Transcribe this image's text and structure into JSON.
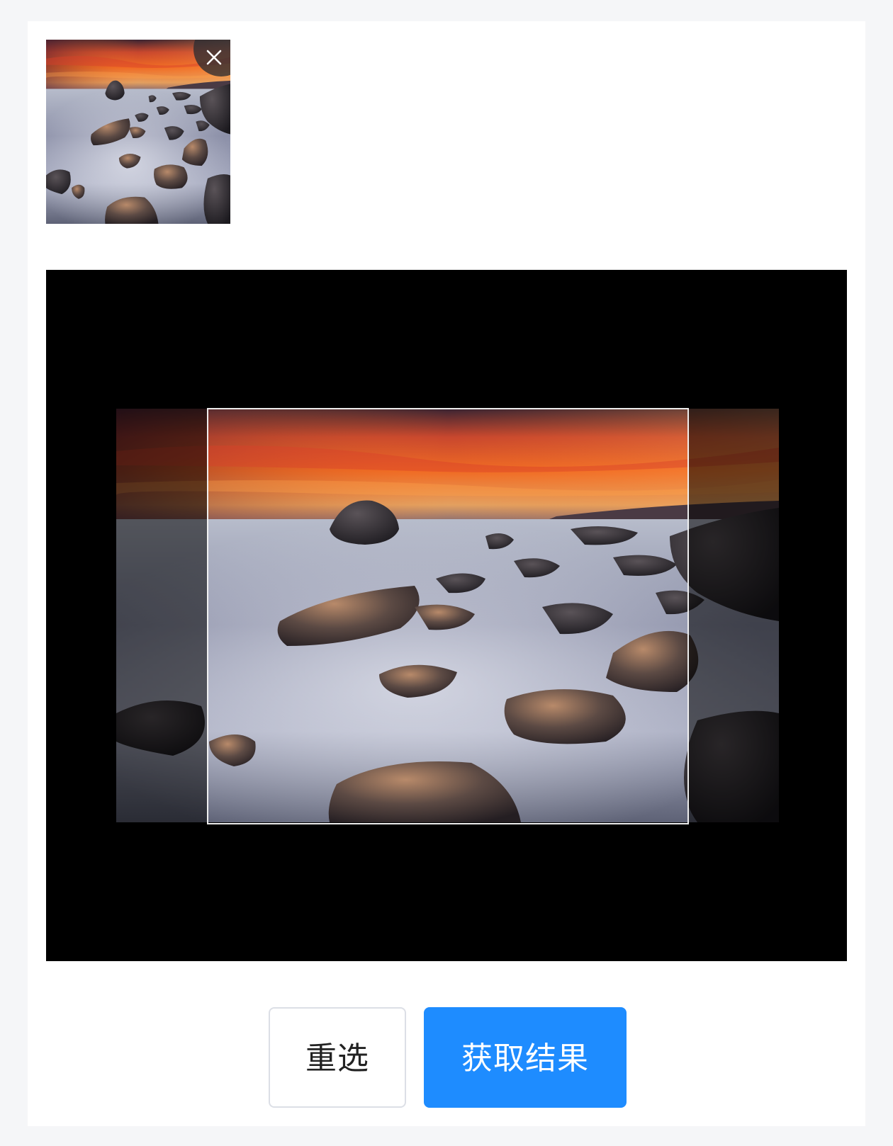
{
  "thumbnail": {
    "image": "coastal-rocks-sunset-photo",
    "close_icon": "close-icon"
  },
  "cropper": {
    "image": "coastal-rocks-sunset-photo"
  },
  "actions": {
    "reset_label": "重选",
    "get_result_label": "获取结果"
  },
  "colors": {
    "primary": "#1e8cff",
    "page_background": "#f5f6f8",
    "card_background": "#ffffff",
    "cropper_background": "#000000"
  }
}
